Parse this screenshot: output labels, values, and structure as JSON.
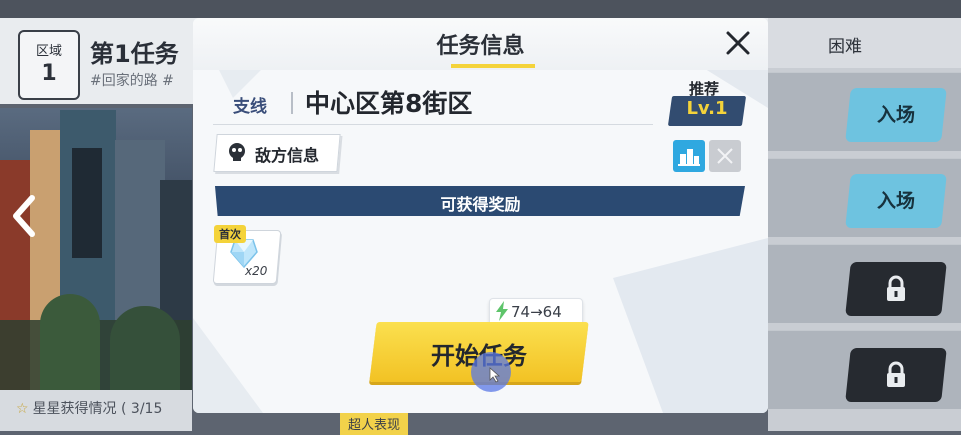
{
  "background": {
    "zone": {
      "label": "区域",
      "number": "1"
    },
    "mission_title": "第1任务",
    "mission_tags": "#回家的路 #",
    "stars_progress": "星星获得情况 ( 3/15",
    "right_panel": {
      "header": "困难",
      "buttons": [
        {
          "label": "入场",
          "locked": false
        },
        {
          "label": "入场",
          "locked": false
        },
        {
          "label": "",
          "locked": true
        },
        {
          "label": "",
          "locked": true
        }
      ]
    },
    "bottom_hint": "超人表现"
  },
  "modal": {
    "title": "任务信息",
    "branch_label": "支线",
    "stage_name": "中心区第8街区",
    "recommend_label": "推荐",
    "recommend_level": "Lv.1",
    "enemy_info_button": "敌方信息",
    "reward_banner": "可获得奖励",
    "rewards": [
      {
        "tag": "首次",
        "icon": "crystal-icon",
        "count": "x20"
      }
    ],
    "stamina": {
      "from": "74",
      "to": "64",
      "arrow": "→"
    },
    "start_button": "开始任务"
  },
  "colors": {
    "accent_yellow": "#f4d33a",
    "navy": "#2b4a72",
    "blue_button": "#2fa8e0"
  }
}
